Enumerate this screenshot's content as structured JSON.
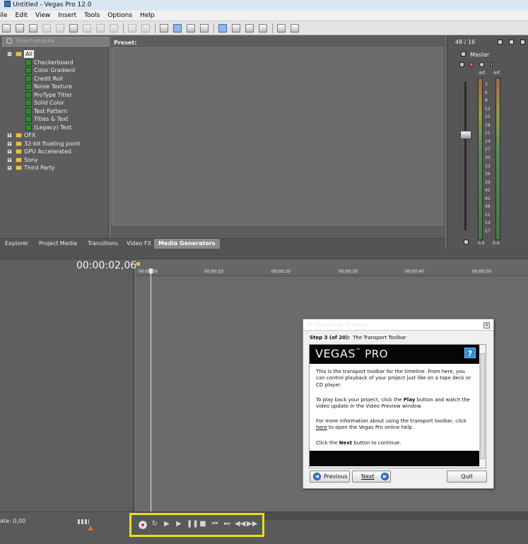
{
  "window": {
    "title": "Untitled - Vegas Pro 12.0"
  },
  "menu": [
    "ile",
    "Edit",
    "View",
    "Insert",
    "Tools",
    "Options",
    "Help"
  ],
  "plugins": {
    "search_placeholder": "Search plug-ins",
    "preset_label": "Preset:",
    "tree": [
      {
        "label": "All",
        "level": 0,
        "type": "folder",
        "expanded": true,
        "selected": true
      },
      {
        "label": "Checkerboard",
        "level": 1,
        "type": "generator"
      },
      {
        "label": "Color Gradient",
        "level": 1,
        "type": "generator"
      },
      {
        "label": "Credit Roll",
        "level": 1,
        "type": "generator"
      },
      {
        "label": "Noise Texture",
        "level": 1,
        "type": "generator"
      },
      {
        "label": "ProType Titler",
        "level": 1,
        "type": "generator"
      },
      {
        "label": "Solid Color",
        "level": 1,
        "type": "generator"
      },
      {
        "label": "Test Pattern",
        "level": 1,
        "type": "generator"
      },
      {
        "label": "Titles & Text",
        "level": 1,
        "type": "generator"
      },
      {
        "label": "(Legacy) Text",
        "level": 1,
        "type": "generator"
      },
      {
        "label": "OFX",
        "level": 0,
        "type": "folder",
        "expanded": false
      },
      {
        "label": "32-bit floating point",
        "level": 0,
        "type": "folder",
        "expanded": false
      },
      {
        "label": "GPU Accelerated",
        "level": 0,
        "type": "folder",
        "expanded": false
      },
      {
        "label": "Sony",
        "level": 0,
        "type": "folder",
        "expanded": false
      },
      {
        "label": "Third Party",
        "level": 0,
        "type": "folder",
        "expanded": false
      }
    ]
  },
  "tabs": [
    {
      "label": "Explorer"
    },
    {
      "label": "Project Media"
    },
    {
      "label": "Transitions"
    },
    {
      "label": "Video FX"
    },
    {
      "label": "Media Generators",
      "active": true
    }
  ],
  "mixer": {
    "sample_info": "48 / 16",
    "master_label": "Master",
    "left_peak": "-Inf.",
    "right_peak": "-Inf.",
    "scale": [
      "3",
      "6",
      "9",
      "12",
      "15",
      "18",
      "21",
      "24",
      "27",
      "30",
      "33",
      "36",
      "39",
      "42",
      "45",
      "48",
      "51",
      "54",
      "57"
    ],
    "left_value": "0.0",
    "right_value": "0.0"
  },
  "timeline": {
    "timecode": "00:00:02,06",
    "ruler": [
      "00:00:00",
      "00:00:10",
      "00:00:20",
      "00:00:30",
      "00:00:40",
      "00:00:50"
    ],
    "rate_label": "ate: 0,00"
  },
  "dialog": {
    "title": "An Overview of Vegas",
    "step": "Step 3 (of 20):",
    "step_title": "The Transport Toolbar",
    "logo_text": "VEGAS",
    "logo_pro": "PRO",
    "help_button": "?",
    "para1": "This is the transport toolbar for the timeline. From here, you can control playback of your project just like on a tape deck or CD player.",
    "para2_a": "To play back your project, click the ",
    "para2_bold": "Play",
    "para2_b": " button and watch the video update in the Video Preview window.",
    "para3_a": "For more information about using the transport toolbar, click ",
    "para3_link": "here",
    "para3_b": " to open the Vegas Pro online help.",
    "para4_a": "Click the ",
    "para4_bold": "Next",
    "para4_b": " button to continue.",
    "previous_label": "Previous",
    "next_label": "Next",
    "quit_label": "Quit"
  },
  "transport": {
    "buttons": [
      "record",
      "loop",
      "play-from-start",
      "play",
      "pause",
      "stop",
      "go-to-start",
      "go-to-end",
      "previous-frame",
      "next-frame"
    ],
    "highlight_color": "#e9dc1e"
  }
}
